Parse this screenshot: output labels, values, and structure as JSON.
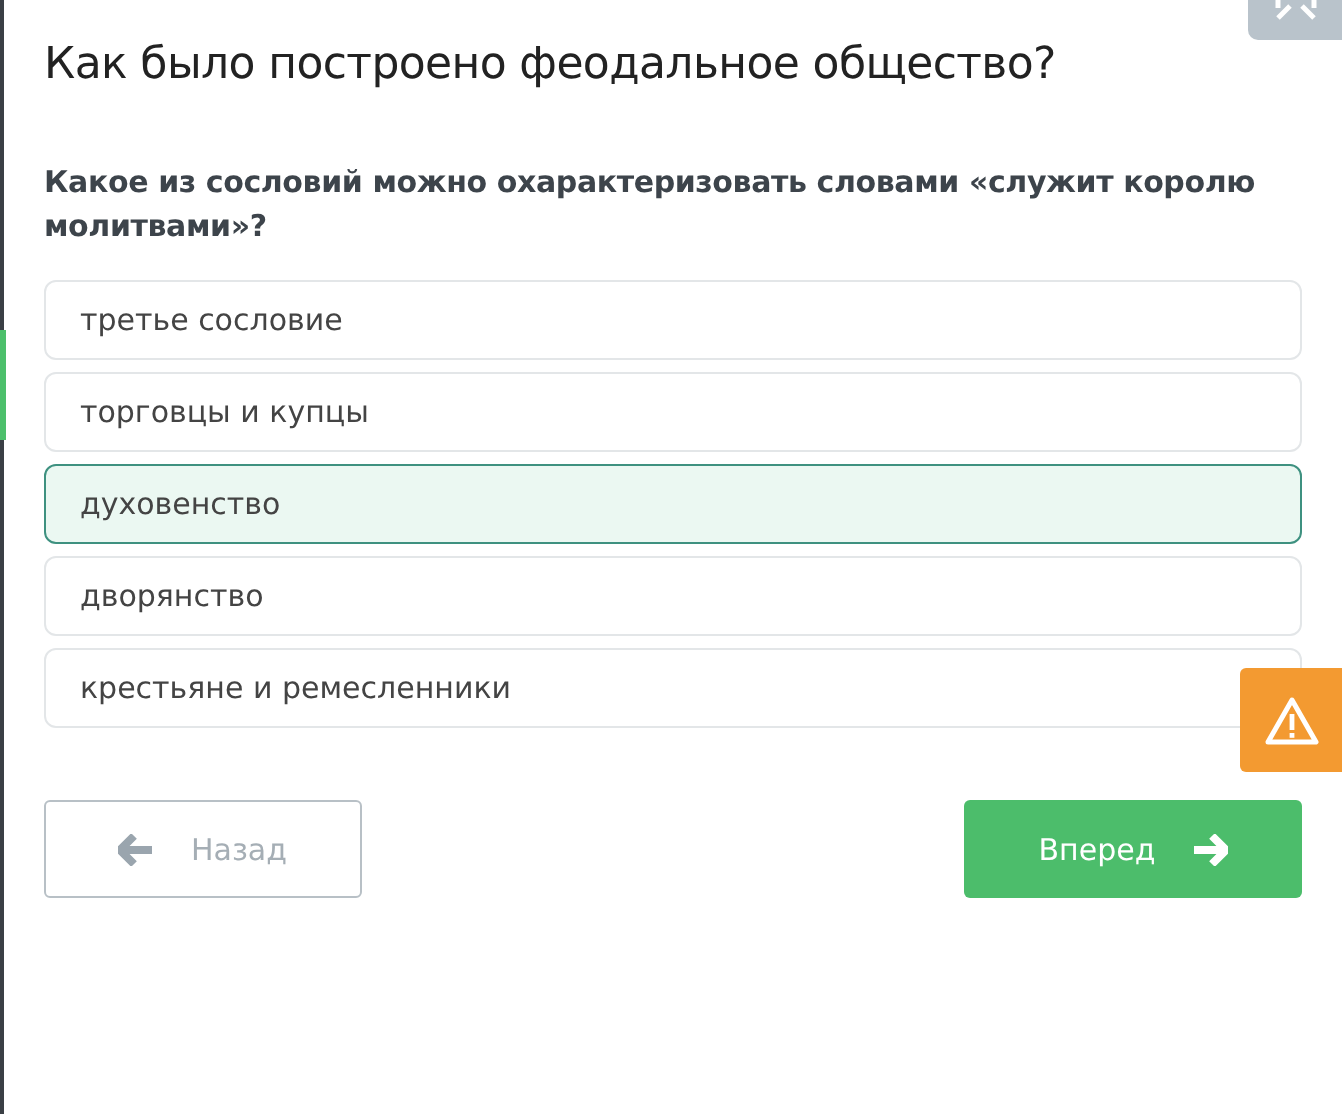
{
  "title": "Как было построено феодальное общество?",
  "question": "Какое из сословий можно охарактеризовать словами «служит королю молитвами»?",
  "options": [
    {
      "label": "третье сословие",
      "selected": false
    },
    {
      "label": "торговцы и купцы",
      "selected": false
    },
    {
      "label": "духовенство",
      "selected": true
    },
    {
      "label": "дворянство",
      "selected": false
    },
    {
      "label": "крестьяне и ремесленники",
      "selected": false
    }
  ],
  "navigation": [
    {
      "kind": "back",
      "label": "Назад"
    },
    {
      "kind": "next",
      "label": "Вперед"
    }
  ]
}
